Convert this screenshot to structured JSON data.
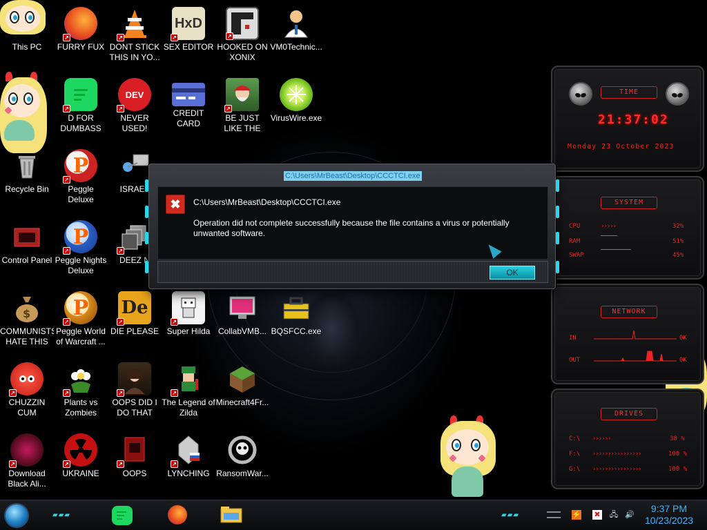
{
  "desktop": {
    "icons": [
      {
        "label": "This PC",
        "icon": "sticker-character-icon"
      },
      {
        "label": "FURRY FUX",
        "icon": "firefox-icon"
      },
      {
        "label": "DONT STICK THIS IN YO...",
        "icon": "vlc-cone-icon"
      },
      {
        "label": "SEX EDITOR",
        "icon": "hxd-editor-icon"
      },
      {
        "label": "HOOKED ON XONIX",
        "icon": "xonix-game-icon"
      },
      {
        "label": "VM0Technic...",
        "icon": "doctor-person-icon"
      },
      {
        "label": "D FOR DUMBASS",
        "icon": "spotify-like-icon"
      },
      {
        "label": "NEVER USED!",
        "icon": "dev-cpp-icon"
      },
      {
        "label": "CREDIT CARD CHECKER",
        "icon": "credit-card-icon"
      },
      {
        "label": "BE JUST LIKE THE DUDE!",
        "icon": "dude-character-icon"
      },
      {
        "label": "VirusWire.exe",
        "icon": "lime-slice-icon"
      },
      {
        "label": "Recycle Bin",
        "icon": "recycle-bin-icon"
      },
      {
        "label": "Peggle Deluxe",
        "icon": "peggle-icon"
      },
      {
        "label": "ISRAEL",
        "icon": "network-icon"
      },
      {
        "label": "Control Panel",
        "icon": "control-panel-icon"
      },
      {
        "label": "Peggle Nights Deluxe",
        "icon": "peggle-nights-icon"
      },
      {
        "label": "DEEZ N",
        "icon": "windows-stack-icon"
      },
      {
        "label": "COMMUNISTS HATE THIS G...",
        "icon": "money-bag-icon"
      },
      {
        "label": "Peggle World of Warcraft ...",
        "icon": "peggle-wow-icon"
      },
      {
        "label": "DIE PLEASE",
        "icon": "de-letters-icon"
      },
      {
        "label": "Super Hilda",
        "icon": "pixel-character-icon"
      },
      {
        "label": "CollabVMB...",
        "icon": "monitor-icon"
      },
      {
        "label": "BQSFCC.exe",
        "icon": "toolbox-icon"
      },
      {
        "label": "CHUZZIN CUM",
        "icon": "chuzzle-icon"
      },
      {
        "label": "Plants vs Zombies",
        "icon": "plants-vs-zombies-icon"
      },
      {
        "label": "OOPS DID I DO THAT",
        "icon": "portrait-woman-icon"
      },
      {
        "label": "The Legend of Zilda",
        "icon": "zelda-like-icon"
      },
      {
        "label": "Minecraft4Fr...",
        "icon": "minecraft-grass-icon"
      },
      {
        "label": "Download Black Ali...",
        "icon": "black-alien-icon"
      },
      {
        "label": "UKRAINE",
        "icon": "radiation-icon"
      },
      {
        "label": "OOPS",
        "icon": "red-book-icon"
      },
      {
        "label": "LYNCHING",
        "icon": "lynching-flag-icon"
      },
      {
        "label": "RansomWar...",
        "icon": "skull-ring-icon"
      }
    ]
  },
  "dialog": {
    "title": "C:\\Users\\MrBeast\\Desktop\\CCCTCI.exe",
    "heading": "C:\\Users\\MrBeast\\Desktop\\CCCTCI.exe",
    "message": "Operation did not complete successfully because the file contains a virus or potentially unwanted software.",
    "ok_label": "OK"
  },
  "widgets": {
    "time": {
      "header": "TIME",
      "clock": "21:37:02",
      "date": "Monday 23 October 2023"
    },
    "system": {
      "header": "SYSTEM",
      "rows": [
        {
          "label": "CPU",
          "value": "32%"
        },
        {
          "label": "RAM",
          "value": "51%"
        },
        {
          "label": "SWAP",
          "value": "45%"
        }
      ]
    },
    "network": {
      "header": "NETWORK",
      "rows": [
        {
          "label": "IN",
          "value": "0K"
        },
        {
          "label": "OUT",
          "value": "0K"
        }
      ]
    },
    "drives": {
      "header": "DRIVES",
      "rows": [
        {
          "label": "C:\\",
          "value": "38 %"
        },
        {
          "label": "F:\\",
          "value": "100 %"
        },
        {
          "label": "G:\\",
          "value": "100 %"
        }
      ]
    }
  },
  "taskbar": {
    "apps": [
      "spotify-like-icon",
      "firefox-icon",
      "file-explorer-icon"
    ],
    "tray_icons": [
      "hide-icon",
      "language-icon",
      "security-flag-icon",
      "network-icon",
      "volume-icon"
    ],
    "time": "9:37 PM",
    "date": "10/23/2023"
  },
  "colors": {
    "widget_red": "#ff2a2a",
    "accent_cyan": "#2dd4ea",
    "clock_blue": "#3ab4ff",
    "error_red": "#cf2a1d"
  }
}
